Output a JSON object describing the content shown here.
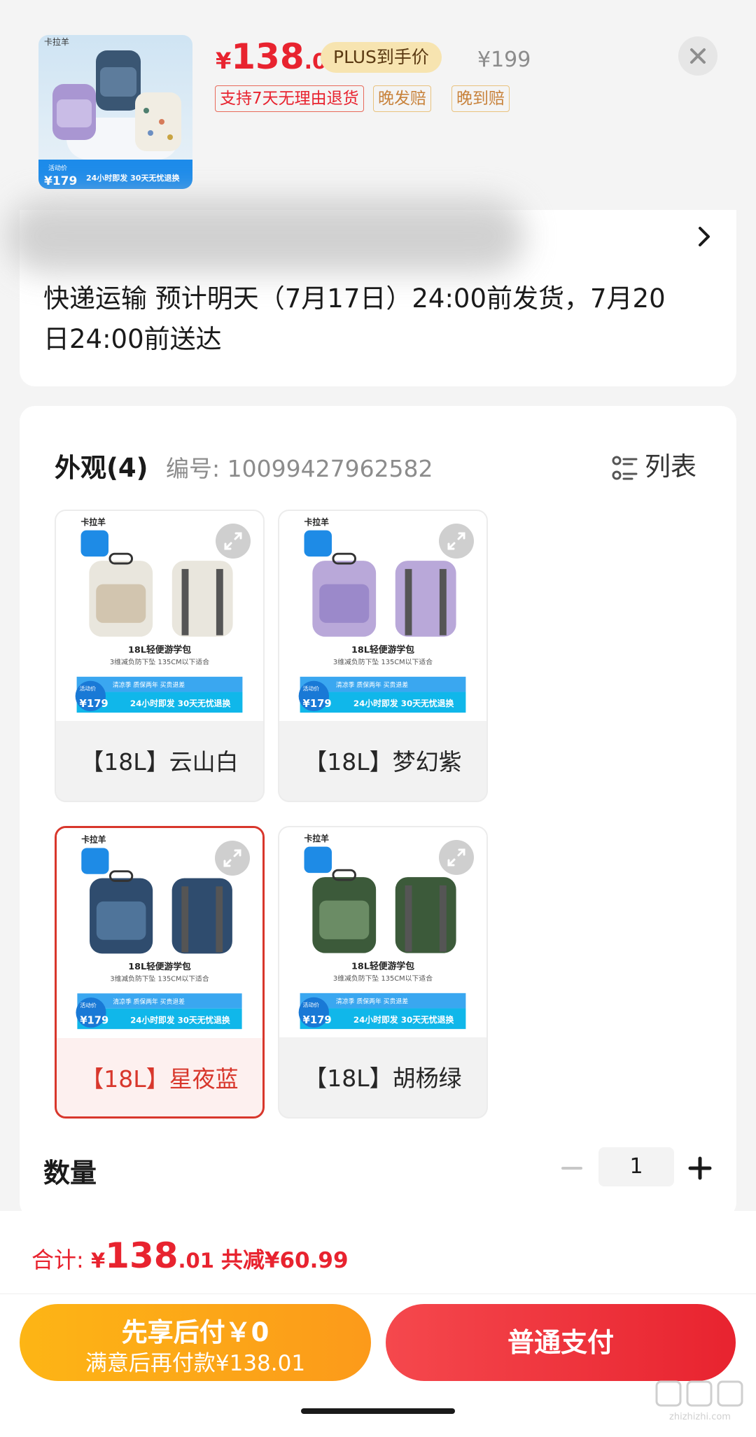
{
  "header": {
    "price": {
      "currency": "¥",
      "integer": "138",
      "decimal": ".01"
    },
    "plus_badge": "PLUS到手价",
    "original_price": "¥199",
    "tags": [
      "支持7天无理由退货",
      "晚发赔",
      "晚到赔"
    ],
    "close_icon": "close-icon",
    "thumbnail": {
      "brand": "卡拉羊",
      "activity_label": "活动价",
      "activity_price": "¥179",
      "banner_text": "24小时即发 30天无忧退换"
    }
  },
  "shipping": {
    "text": "快递运输 预计明天（7月17日）24:00前发货，7月20日24:00前送达",
    "arrow_icon": "chevron-right-icon"
  },
  "spec": {
    "title": "外观(4)",
    "code": "编号: 10099427962582",
    "list_toggle": "列表",
    "options": [
      {
        "label": "【18L】云山白",
        "selected": false,
        "bag_color": "#e9e6dd",
        "accent": "#c7b79b"
      },
      {
        "label": "【18L】梦幻紫",
        "selected": false,
        "bag_color": "#b9a8d9",
        "accent": "#8e7cc3"
      },
      {
        "label": "【18L】星夜蓝",
        "selected": true,
        "bag_color": "#2f4c6e",
        "accent": "#5d86ad"
      },
      {
        "label": "【18L】胡杨绿",
        "selected": false,
        "bag_color": "#3c5a3a",
        "accent": "#7fa177"
      }
    ],
    "card_text": {
      "brand": "卡拉羊",
      "product": "18L轻便游学包",
      "sub": "3维减负防下坠  135CM以下适合",
      "activity_label": "活动价",
      "activity_price": "¥179",
      "promo_tags": "清凉季  质保两年 买贵退差",
      "promo": "24小时即发 30天无忧退换"
    }
  },
  "quantity": {
    "label": "数量",
    "value": "1"
  },
  "footer": {
    "total_label": "合计: ",
    "total_currency": "¥",
    "total_integer": "138",
    "total_decimal": ".01",
    "savings": "共减¥60.99",
    "bnpl_title": "先享后付￥0",
    "bnpl_sub": "满意后再付款¥138.01",
    "pay_button": "普通支付"
  },
  "colors": {
    "accent_red": "#e8232f",
    "plus_gold": "#f7e4b0",
    "bnpl_orange": "#fdb515",
    "selected_border": "#d8372c"
  },
  "watermark": "zhizhizhi.com"
}
